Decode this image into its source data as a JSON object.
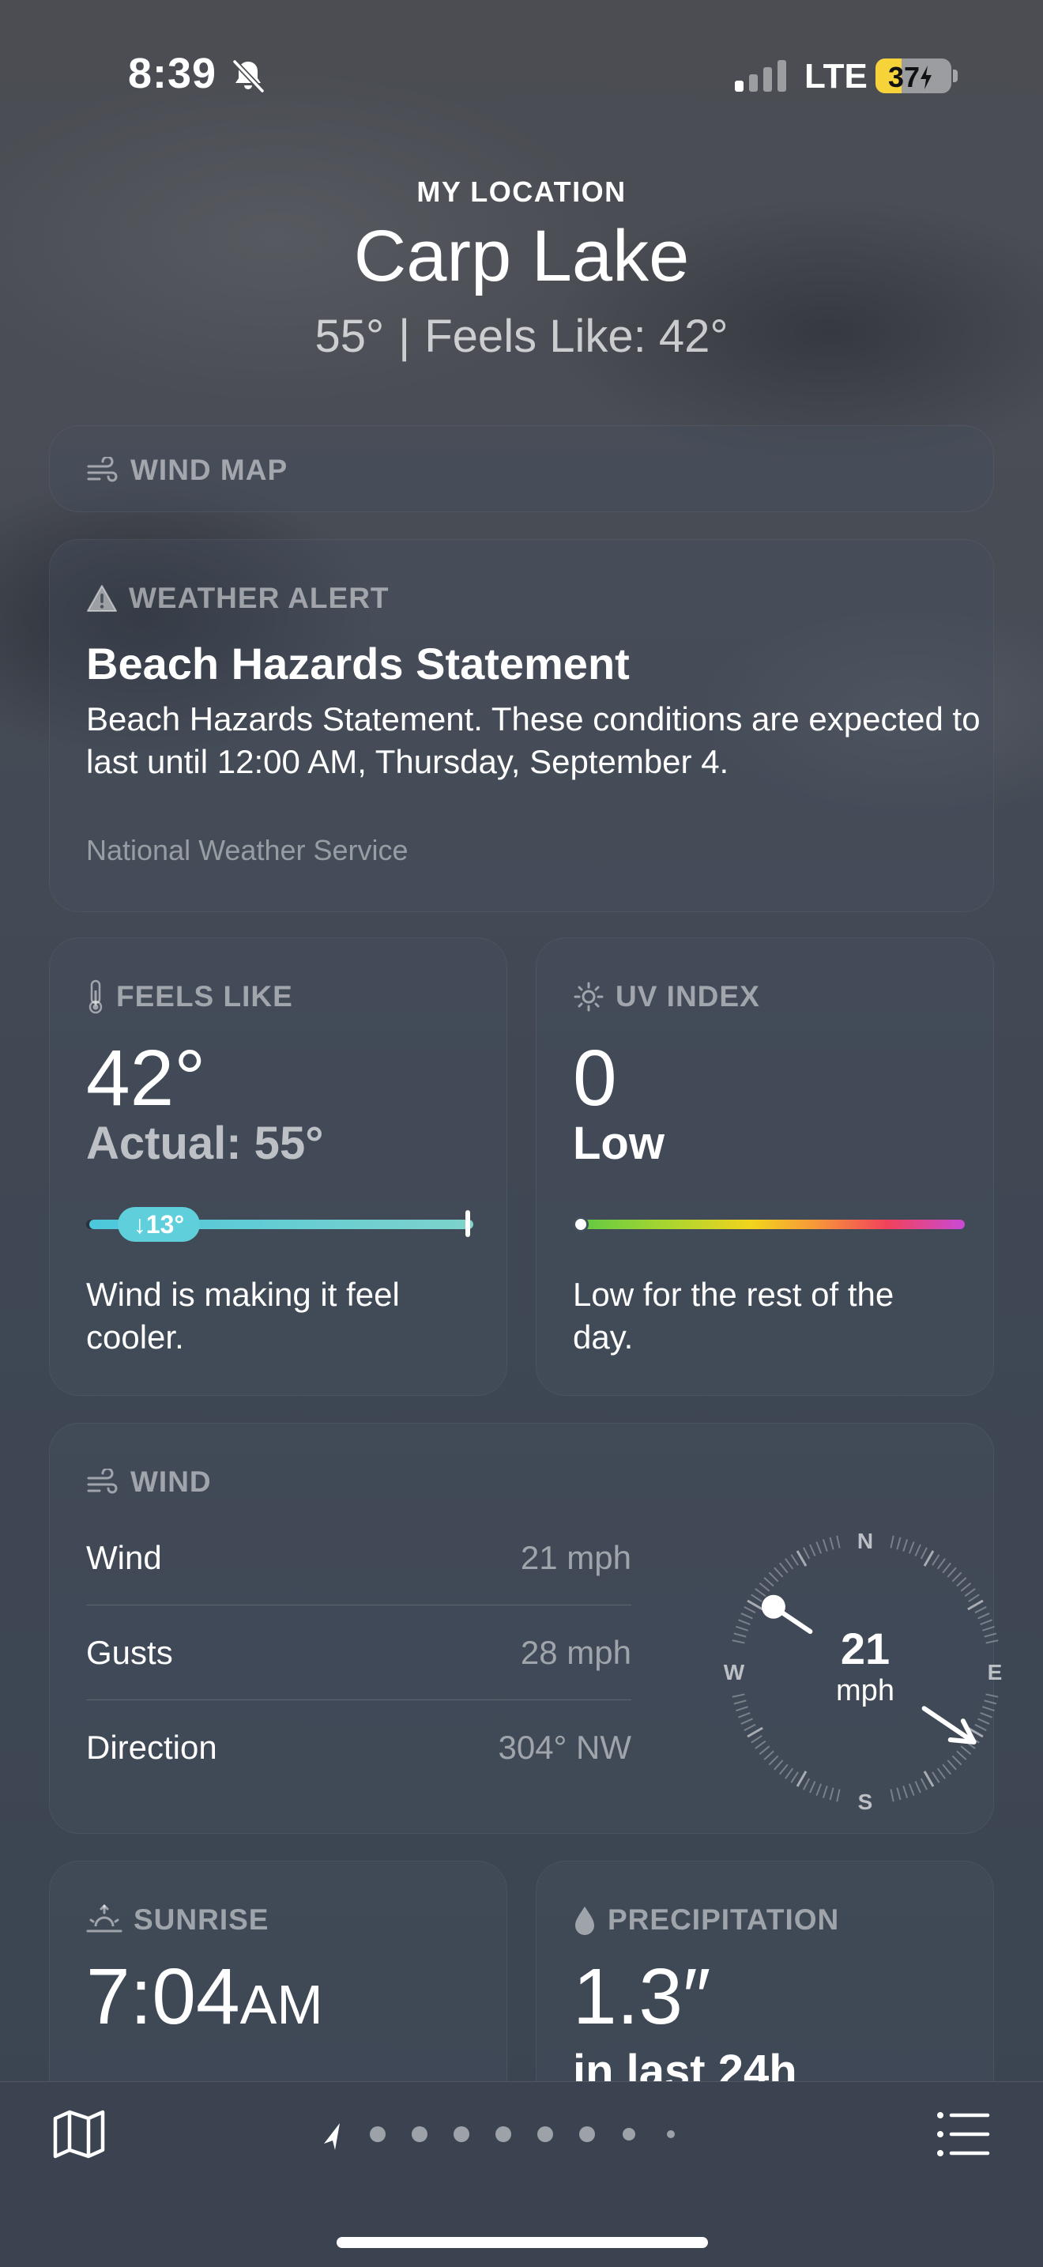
{
  "status_bar": {
    "time": "8:39",
    "network": "LTE",
    "battery": "37",
    "battery_level": 0.37,
    "icons": [
      "bell-slash-icon",
      "signal-icon",
      "charging-bolt-icon"
    ]
  },
  "header": {
    "location_label": "MY LOCATION",
    "city": "Carp Lake",
    "temperature": "55°",
    "separator": "|",
    "feels_like": "Feels Like: 42°"
  },
  "wind_map": {
    "label": "WIND MAP",
    "icon": "wind-icon"
  },
  "weather_alert": {
    "label": "WEATHER ALERT",
    "icon": "warning-triangle-icon",
    "title": "Beach Hazards Statement",
    "body": "Beach Hazards Statement. These conditions are expected to last until 12:00 AM, Thursday, September 4.",
    "source": "National Weather Service"
  },
  "feels_like_card": {
    "label": "FEELS LIKE",
    "icon": "thermometer-icon",
    "value": "42°",
    "actual": "Actual: 55°",
    "difference_badge": "↓13°",
    "note": "Wind is making it feel cooler."
  },
  "uv_card": {
    "label": "UV INDEX",
    "icon": "sun-icon",
    "value": "0",
    "level": "Low",
    "note": "Low for the rest of the day."
  },
  "wind_card": {
    "label": "WIND",
    "icon": "wind-icon",
    "rows": [
      {
        "label": "Wind",
        "value": "21 mph"
      },
      {
        "label": "Gusts",
        "value": "28 mph"
      },
      {
        "label": "Direction",
        "value": "304° NW"
      }
    ],
    "compass": {
      "speed": "21",
      "unit": "mph",
      "n": "N",
      "e": "E",
      "s": "S",
      "w": "W",
      "direction_degrees": 304
    }
  },
  "sunrise_card": {
    "label": "SUNRISE",
    "icon": "sunrise-icon",
    "time": "7:04",
    "ampm": "AM"
  },
  "precipitation_card": {
    "label": "PRECIPITATION",
    "icon": "drop-icon",
    "value": "1.3″",
    "period": "in last 24h"
  },
  "toolbar": {
    "map_icon": "map-icon",
    "list_icon": "list-icon",
    "location_icon": "location-arrow-icon",
    "page_count": 9,
    "current_page": 0
  },
  "colors": {
    "feels_like_gradient": [
      "#4cc7dc",
      "#7ed3cb"
    ],
    "uv_gradient": [
      "#5ec944",
      "#f2d41d",
      "#f7953a",
      "#f1425b",
      "#c94ad6"
    ],
    "battery_accent": "#f7d33a"
  }
}
